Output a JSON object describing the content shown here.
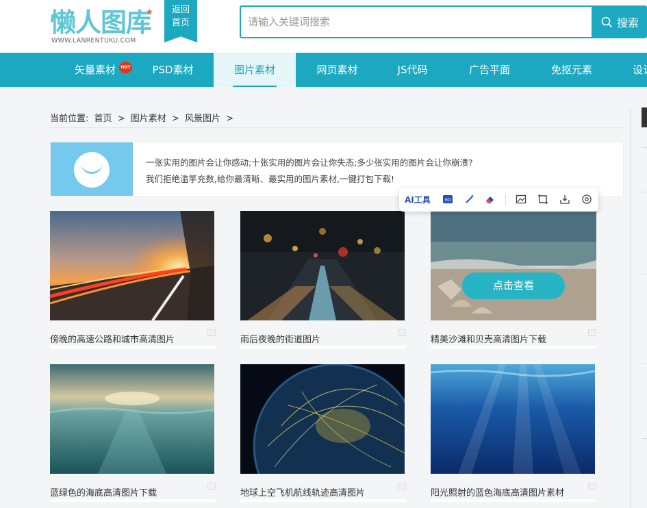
{
  "header": {
    "logo_text": "懒人图库",
    "logo_url": "WWW.LANRENTUKU.COM",
    "back_home_line1": "返回",
    "back_home_line2": "首页",
    "search_placeholder": "请输入关键词搜索",
    "search_button": "搜索"
  },
  "nav": {
    "items": [
      {
        "label": "矢量素材"
      },
      {
        "label": "PSD素材"
      },
      {
        "label": "图片素材",
        "active": true
      },
      {
        "label": "网页素材"
      },
      {
        "label": "JS代码"
      },
      {
        "label": "广告平面"
      },
      {
        "label": "免抠元素"
      },
      {
        "label": "设计"
      }
    ],
    "hot_badge": "HOT"
  },
  "breadcrumb": {
    "prefix": "当前位置:",
    "items": [
      "首页",
      "图片素材",
      "风景图片"
    ],
    "separator": ">"
  },
  "banner": {
    "line1": "一张实用的图片会让你感动;十张实用的图片会让你失态;多少张实用的图片会让你崩溃?",
    "line2": "我们拒绝滥竽充数,给你最清晰、最实用的图片素材,一键打包下载!"
  },
  "ai_toolbar": {
    "label": "AI工具",
    "icons": [
      "hd-icon",
      "magic-wand-icon",
      "eraser-icon",
      "image-edit-icon",
      "crop-icon",
      "download-icon",
      "settings-icon"
    ]
  },
  "cards": [
    {
      "title": "傍晚的高速公路和城市高清图片"
    },
    {
      "title": "雨后夜晚的街道图片"
    },
    {
      "title": "精美沙滩和贝壳高清图片下载",
      "hover_button": "点击查看"
    },
    {
      "title": "蓝绿色的海底高清图片下载"
    },
    {
      "title": "地球上空飞机航线轨迹高清图片"
    },
    {
      "title": "阳光照射的蓝色海底高清图片素材"
    }
  ],
  "colors": {
    "brand": "#1ba8c0",
    "hot": "#e4331f",
    "view_button": "#27b5c5"
  }
}
